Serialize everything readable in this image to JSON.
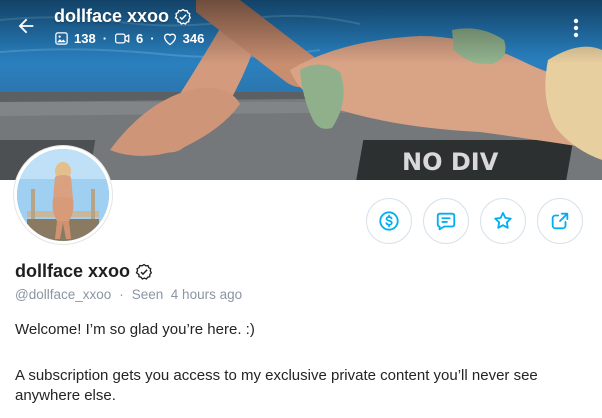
{
  "header": {
    "display_name": "dollface xxoo",
    "stats": [
      {
        "icon": "image-icon",
        "value": "138"
      },
      {
        "icon": "video-icon",
        "value": "6"
      },
      {
        "icon": "heart-icon",
        "value": "346"
      }
    ],
    "separator": "·"
  },
  "profile": {
    "display_name": "dollface xxoo",
    "handle": "@dollface_xxoo",
    "separator": "·",
    "last_seen": "Seen  4 hours ago",
    "bio": [
      "Welcome! I’m so glad you’re here. :)",
      "A subscription gets you access to my exclusive private content you’ll never see anywhere else."
    ]
  },
  "cover": {
    "sign_text": "NO DIV"
  },
  "actions": [
    {
      "icon": "tip-dollar-icon"
    },
    {
      "icon": "message-icon"
    },
    {
      "icon": "star-icon"
    },
    {
      "icon": "share-icon"
    }
  ],
  "colors": {
    "accent": "#00aff0",
    "muted": "#8a96a3",
    "border": "#d7e2ea"
  }
}
